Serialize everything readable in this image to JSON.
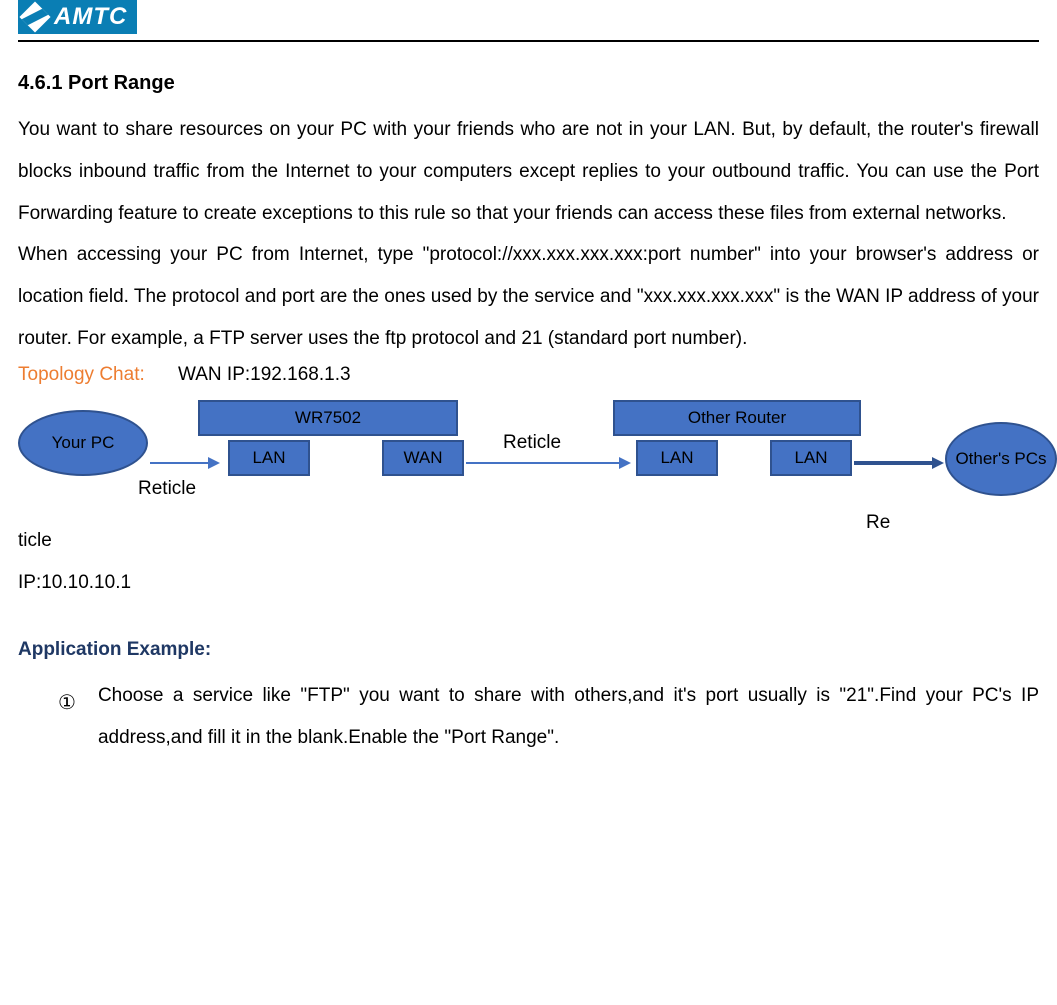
{
  "logo": {
    "text": "AMTC"
  },
  "section": {
    "heading": "4.6.1 Port Range",
    "paragraph1": "You want to share resources on your PC with your friends who are not in your LAN. But, by default, the router's firewall blocks inbound traffic from the Internet to your computers except replies to your outbound traffic. You can use the Port Forwarding feature to create exceptions to this rule so that your friends can access these files from external networks.",
    "paragraph2": "When accessing your PC from Internet, type \"protocol://xxx.xxx.xxx.xxx:port number\" into your browser's address or location field. The protocol and port are the ones used by the service and \"xxx.xxx.xxx.xxx\" is the WAN IP address of your router. For example, a FTP server uses the ftp protocol and 21 (standard port number)."
  },
  "topology": {
    "label": "Topology Chat:",
    "wan_ip": "WAN IP:192.168.1.3",
    "your_pc": "Your PC",
    "router_model": "WR7502",
    "other_router": "Other Router",
    "port_lan": "LAN",
    "port_wan": "WAN",
    "others_pcs": "Other's PCs",
    "reticle": "Reticle",
    "reticle_split_pre": "Re",
    "reticle_split_post": "ticle",
    "ip_line": "IP:10.10.10.1"
  },
  "application": {
    "heading": "Application Example:",
    "step1_num": "①",
    "step1_text": "Choose a service like \"FTP\" you want to share with others,and it's port usually is \"21\".Find your PC's IP address,and fill it in the blank.Enable the \"Port Range\"."
  }
}
